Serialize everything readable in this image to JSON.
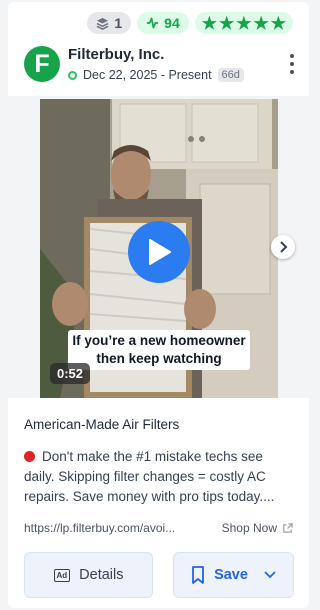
{
  "badges": {
    "count": "1",
    "score": "94",
    "stars": 5
  },
  "advertiser": {
    "initial": "F",
    "name": "Filterbuy, Inc.",
    "date_range": "Dec 22, 2025 - Present",
    "days": "66d"
  },
  "media": {
    "caption_line1": "If you’re a new homeowner",
    "caption_line2": "then keep watching",
    "duration": "0:52"
  },
  "ad": {
    "headline": "American-Made Air Filters",
    "body": "Don't make the #1 mistake techs see daily. Skipping filter changes = costly AC repairs. Save money with pro tips today....",
    "link": "https://lp.filterbuy.com/avoi...",
    "cta": "Shop Now"
  },
  "actions": {
    "details_label": "Details",
    "save_label": "Save",
    "ad_icon_text": "Ad"
  },
  "colors": {
    "accent": "#2563eb",
    "brand_green": "#16a34a",
    "play_blue": "#2b7cf0",
    "status_red": "#dc2626"
  }
}
